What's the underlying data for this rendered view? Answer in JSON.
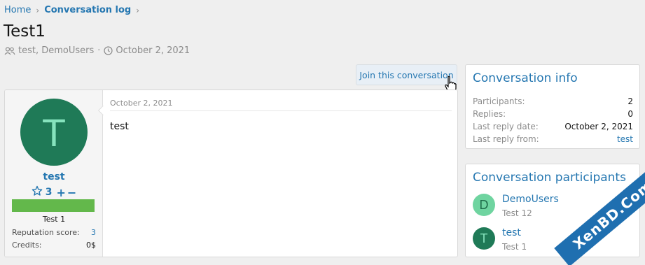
{
  "breadcrumb": {
    "home": "Home",
    "section": "Conversation log"
  },
  "page": {
    "title": "Test1"
  },
  "meta": {
    "participants": "test, DemoUsers",
    "date": "October 2, 2021"
  },
  "actions": {
    "join_label": "Join this conversation"
  },
  "message": {
    "author": {
      "initial": "T",
      "name": "test",
      "rating_value": "3",
      "title": "Test 1",
      "reputation_label": "Reputation score:",
      "reputation_value": "3",
      "credits_label": "Credits:",
      "credits_value": "0$"
    },
    "date": "October 2, 2021",
    "body": "test"
  },
  "info": {
    "title": "Conversation info",
    "rows": [
      {
        "label": "Participants:",
        "value": "2"
      },
      {
        "label": "Replies:",
        "value": "0"
      },
      {
        "label": "Last reply date:",
        "value": "October 2, 2021"
      },
      {
        "label": "Last reply from:",
        "value": "test"
      }
    ]
  },
  "participants": {
    "title": "Conversation participants",
    "items": [
      {
        "initial": "D",
        "name": "DemoUsers",
        "sub": "Test 12",
        "bg": "#6fd4a0",
        "fg": "#1f6d4a"
      },
      {
        "initial": "T",
        "name": "test",
        "sub": "Test 1",
        "bg": "#1f7a57",
        "fg": "#86e3bd"
      }
    ]
  },
  "watermark": {
    "text": "XenBD.Com"
  }
}
